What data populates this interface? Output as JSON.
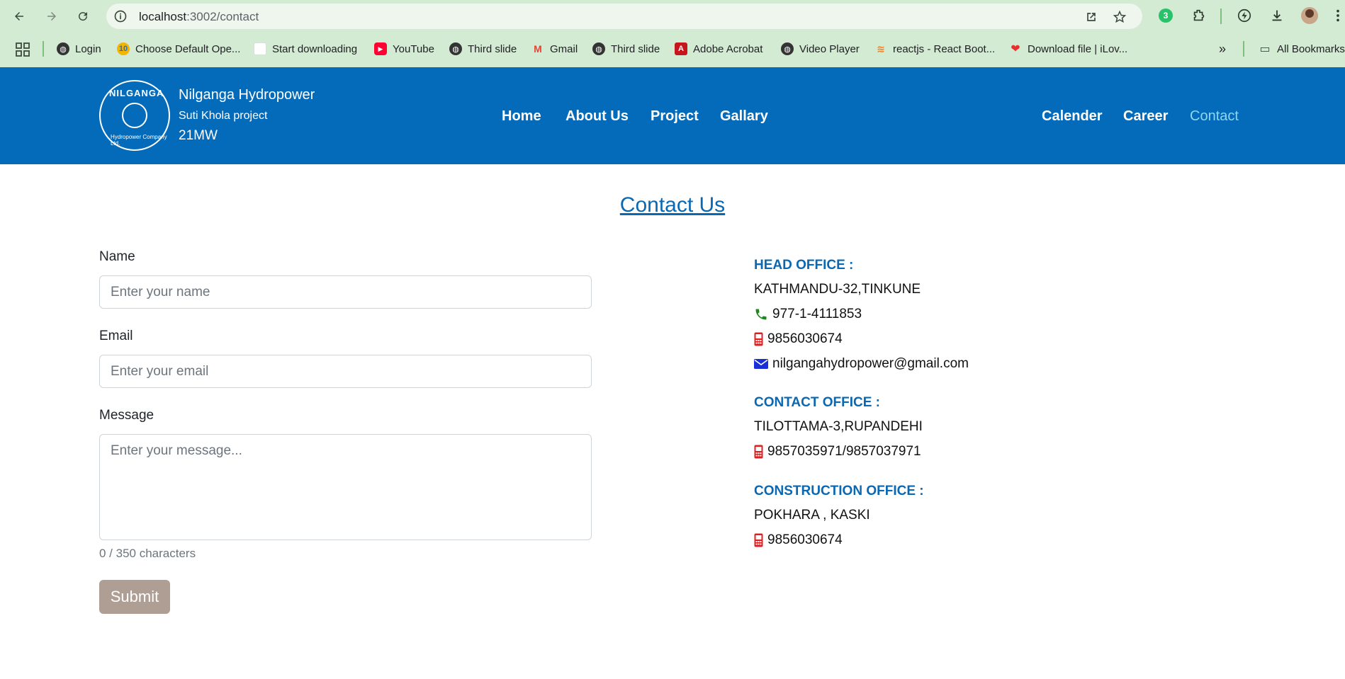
{
  "browser": {
    "url_host": "localhost",
    "url_path": ":3002/contact",
    "extension_badge": "3",
    "bookmarks": [
      {
        "label": "Login",
        "icon": "globe-icon"
      },
      {
        "label": "Choose Default Ope...",
        "icon": "app-icon"
      },
      {
        "label": "Start downloading",
        "icon": "blank-icon"
      },
      {
        "label": "YouTube",
        "icon": "youtube-icon"
      },
      {
        "label": "Third slide",
        "icon": "globe-icon"
      },
      {
        "label": "Gmail",
        "icon": "gmail-icon"
      },
      {
        "label": "Third slide",
        "icon": "globe-icon"
      },
      {
        "label": "Adobe Acrobat",
        "icon": "acrobat-icon"
      },
      {
        "label": "Video Player",
        "icon": "globe-icon"
      },
      {
        "label": "reactjs - React Boot...",
        "icon": "stackoverflow-icon"
      },
      {
        "label": "Download file | iLov...",
        "icon": "heart-icon"
      }
    ],
    "more_bookmarks": "»",
    "all_bookmarks": "All Bookmarks"
  },
  "header": {
    "logo_text": "NILGANGA",
    "logo_subtext": "Hydropower Company Ltd.",
    "brand_name": "Nilganga Hydropower",
    "brand_sub": "Suti Khola project",
    "brand_capacity": "21MW",
    "nav_left": [
      "Home",
      "About Us",
      "Project",
      "Gallary"
    ],
    "nav_right": [
      "Calender",
      "Career",
      "Contact"
    ],
    "active": "Contact"
  },
  "page": {
    "title": "Contact Us"
  },
  "form": {
    "name_label": "Name",
    "name_placeholder": "Enter your name",
    "email_label": "Email",
    "email_placeholder": "Enter your email",
    "message_label": "Message",
    "message_placeholder": "Enter your message...",
    "char_count": "0 / 350 characters",
    "submit_label": "Submit"
  },
  "offices": {
    "head": {
      "heading": "HEAD OFFICE :",
      "address": "KATHMANDU-32,TINKUNE",
      "phone": "977-1-4111853",
      "mobile": "9856030674",
      "email": "nilgangahydropower@gmail.com"
    },
    "contact": {
      "heading": "CONTACT OFFICE :",
      "address": "TILOTTAMA-3,RUPANDEHI",
      "mobile": "9857035971/9857037971"
    },
    "construction": {
      "heading": "CONSTRUCTION OFFICE :",
      "address": "POKHARA , KASKI",
      "mobile": "9856030674"
    }
  },
  "colors": {
    "header_bg": "#046bbb",
    "accent": "#0a67b2",
    "active_nav": "#8dd7ee",
    "submit_bg": "#ae9e93",
    "phone_icon": "#1a8a1a",
    "mobile_icon": "#e02020",
    "mail_icon": "#1a2fd6"
  }
}
